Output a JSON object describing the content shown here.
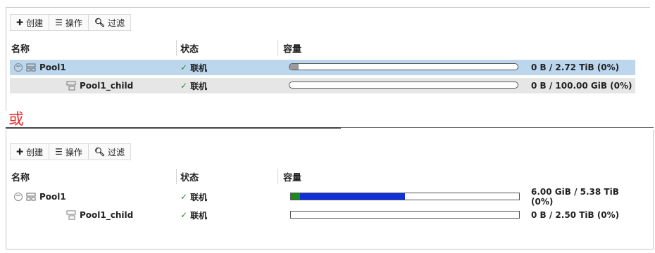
{
  "toolbar": {
    "create_label": "创建",
    "actions_label": "操作",
    "filter_label": "过滤",
    "create_icon": "plus-icon",
    "actions_icon": "list-icon",
    "filter_icon": "search-icon"
  },
  "columns": {
    "name": "名称",
    "status": "状态",
    "capacity": "容量"
  },
  "separator_label": "或",
  "top_table": {
    "rows": [
      {
        "name": "Pool1",
        "status": "联机",
        "capacity_text": "0 B / 2.72 TiB (0%)",
        "usage_fraction": 0.0
      },
      {
        "name": "Pool1_child",
        "status": "联机",
        "capacity_text": "0 B / 100.00 GiB (0%)",
        "usage_fraction": 0.0
      }
    ]
  },
  "bottom_table": {
    "rows": [
      {
        "name": "Pool1",
        "status": "联机",
        "capacity_text": "6.00 GiB / 5.38 TiB (0%)",
        "usage_fraction": 0.5
      },
      {
        "name": "Pool1_child",
        "status": "联机",
        "capacity_text": "0 B / 2.50 TiB (0%)",
        "usage_fraction": 0.0
      }
    ]
  },
  "colors": {
    "selected_row": "#bcd6ee",
    "alt_row": "#e6e6e6",
    "status_ok": "#2e8b2e",
    "or_label": "#e53030",
    "bar_green": "#1c8a1c",
    "bar_blue": "#1030d8"
  }
}
